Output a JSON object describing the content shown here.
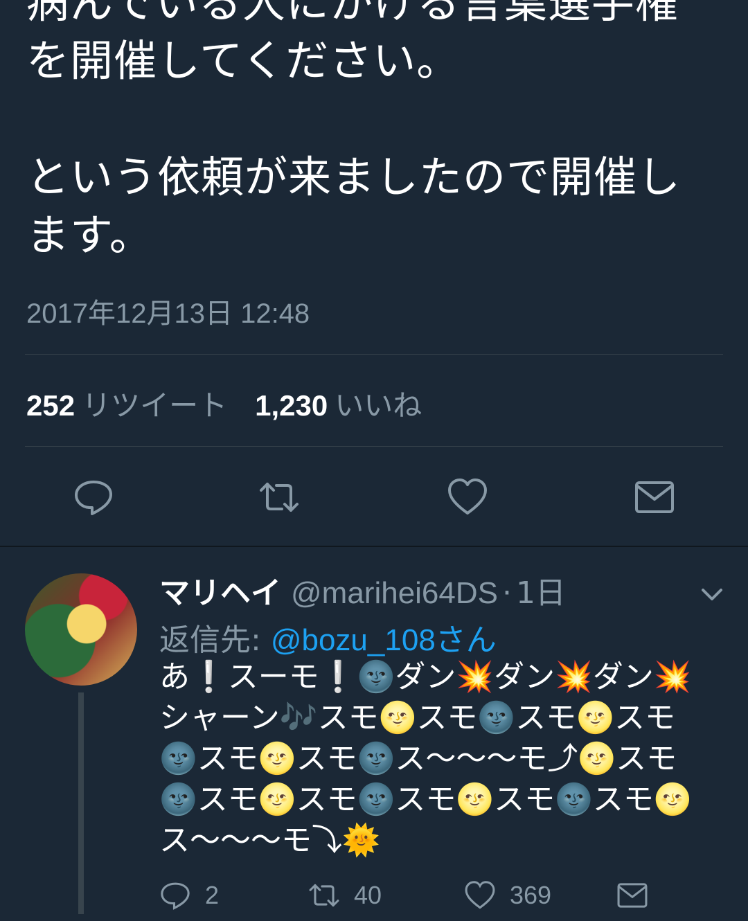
{
  "tweet": {
    "lines": [
      "病んでいる人にかける言葉選手権",
      "を開催してください。",
      "という依頼が来ましたので開催し",
      "ます。"
    ],
    "timestamp": "2017年12月13日 12:48",
    "retweets_count": "252",
    "retweets_label": "リツイート",
    "likes_count": "1,230",
    "likes_label": "いいね"
  },
  "action_icons": [
    "reply-icon",
    "retweet-icon",
    "like-icon",
    "dm-icon"
  ],
  "reply": {
    "name": "マリヘイ",
    "handle": "@marihei64DS",
    "separator": "·",
    "time": "1日",
    "reply_to_label": "返信先:",
    "reply_to_mention": "@bozu_108さん",
    "lines": [
      "あ❕スーモ❕🌚ダン💥ダン💥ダン💥",
      "シャーン🎶スモ🌝スモ🌚スモ🌝スモ",
      "🌚スモ🌝スモ🌚ス〜〜〜モ⤴🌝スモ",
      "🌚スモ🌝スモ🌚スモ🌝スモ🌚スモ🌝",
      "ス〜〜〜モ⤵🌞"
    ],
    "reply_count": "2",
    "retweet_count": "40",
    "like_count": "369"
  },
  "colors": {
    "background": "#1b2836",
    "text": "#ffffff",
    "muted": "#8899a6",
    "link": "#1da1f2",
    "divider": "#38444d"
  }
}
